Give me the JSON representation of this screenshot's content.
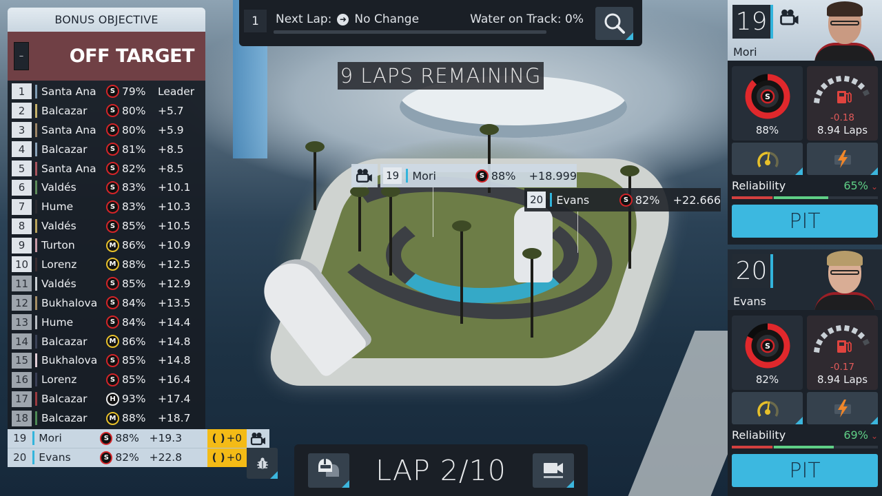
{
  "bonus_objective": {
    "title": "BONUS OBJECTIVE",
    "minus_label": "–",
    "status": "OFF TARGET"
  },
  "standings": [
    {
      "pos": "1",
      "driver": "Santa Ana",
      "tyre": "S",
      "wear": "79%",
      "gap": "Leader",
      "team_color": "#7f9bb3"
    },
    {
      "pos": "2",
      "driver": "Balcazar",
      "tyre": "S",
      "wear": "80%",
      "gap": "+5.7",
      "team_color": "#c7b26a"
    },
    {
      "pos": "3",
      "driver": "Santa Ana",
      "tyre": "S",
      "wear": "80%",
      "gap": "+5.9",
      "team_color": "#9c8566"
    },
    {
      "pos": "4",
      "driver": "Balcazar",
      "tyre": "S",
      "wear": "81%",
      "gap": "+8.5",
      "team_color": "#8aa3ba"
    },
    {
      "pos": "5",
      "driver": "Santa Ana",
      "tyre": "S",
      "wear": "82%",
      "gap": "+8.5",
      "team_color": "#a8545d"
    },
    {
      "pos": "6",
      "driver": "Valdés",
      "tyre": "S",
      "wear": "83%",
      "gap": "+10.1",
      "team_color": "#5d8c5a"
    },
    {
      "pos": "7",
      "driver": "Hume",
      "tyre": "S",
      "wear": "83%",
      "gap": "+10.3",
      "team_color": "#2a2a30"
    },
    {
      "pos": "8",
      "driver": "Valdés",
      "tyre": "S",
      "wear": "85%",
      "gap": "+10.5",
      "team_color": "#b9a45c"
    },
    {
      "pos": "9",
      "driver": "Turton",
      "tyre": "M",
      "wear": "86%",
      "gap": "+10.9",
      "team_color": "#c79aa6"
    },
    {
      "pos": "10",
      "driver": "Lorenz",
      "tyre": "M",
      "wear": "88%",
      "gap": "+12.5",
      "team_color": "#3a2c30"
    },
    {
      "pos": "11",
      "driver": "Valdés",
      "tyre": "S",
      "wear": "85%",
      "gap": "+12.9",
      "team_color": "#c9cdd2"
    },
    {
      "pos": "12",
      "driver": "Bukhalova",
      "tyre": "S",
      "wear": "84%",
      "gap": "+13.5",
      "team_color": "#a68f66"
    },
    {
      "pos": "13",
      "driver": "Hume",
      "tyre": "S",
      "wear": "84%",
      "gap": "+14.4",
      "team_color": "#b8bcc2"
    },
    {
      "pos": "14",
      "driver": "Balcazar",
      "tyre": "M",
      "wear": "86%",
      "gap": "+14.8",
      "team_color": "#3b4256"
    },
    {
      "pos": "15",
      "driver": "Bukhalova",
      "tyre": "S",
      "wear": "85%",
      "gap": "+14.8",
      "team_color": "#e1cdd6"
    },
    {
      "pos": "16",
      "driver": "Lorenz",
      "tyre": "S",
      "wear": "85%",
      "gap": "+16.4",
      "team_color": "#3a3f55"
    },
    {
      "pos": "17",
      "driver": "Balcazar",
      "tyre": "H",
      "wear": "93%",
      "gap": "+17.4",
      "team_color": "#9a3a40"
    },
    {
      "pos": "18",
      "driver": "Balcazar",
      "tyre": "M",
      "wear": "88%",
      "gap": "+18.7",
      "team_color": "#4d8a55"
    }
  ],
  "player_rows": [
    {
      "pos": "19",
      "driver": "Mori",
      "tyre": "S",
      "wear": "88%",
      "gap": "+19.3",
      "bonus": "+0"
    },
    {
      "pos": "20",
      "driver": "Evans",
      "tyre": "S",
      "wear": "82%",
      "gap": "+22.8",
      "bonus": "+0"
    }
  ],
  "topbar": {
    "lap_index": "1",
    "next_lap_label": "Next Lap:",
    "next_lap_value": "No Change",
    "water_label": "Water on Track:",
    "water_value": "0%"
  },
  "laps_remaining": "9 LAPS REMAINING",
  "track_tags": [
    {
      "pos": "19",
      "driver": "Mori",
      "tyre": "S",
      "wear": "88%",
      "gap": "+18.999"
    },
    {
      "pos": "20",
      "driver": "Evans",
      "tyre": "S",
      "wear": "82%",
      "gap": "+22.666"
    }
  ],
  "lap_counter": "LAP 2/10",
  "drivers": [
    {
      "number": "19",
      "name": "Mori",
      "tyre": "S",
      "tyre_wear": "88%",
      "tyre_wear_fraction": 0.88,
      "fuel_delta": "-0.18",
      "fuel_laps": "8.94 Laps",
      "reliability_label": "Reliability",
      "reliability_value": "65%",
      "reliability_fraction": 0.65,
      "pit_label": "PIT"
    },
    {
      "number": "20",
      "name": "Evans",
      "tyre": "S",
      "tyre_wear": "82%",
      "tyre_wear_fraction": 0.82,
      "fuel_delta": "-0.17",
      "fuel_laps": "8.94 Laps",
      "reliability_label": "Reliability",
      "reliability_value": "69%",
      "reliability_fraction": 0.69,
      "pit_label": "PIT"
    }
  ],
  "colors": {
    "accent": "#3cb8e0",
    "soft_tyre": "#d32428",
    "medium_tyre": "#e7c02a",
    "hard_tyre": "#eaeaea",
    "off_target": "#704045",
    "bonus_gold": "#f4bb16",
    "reliability_good": "#5fcf86",
    "reliability_bad": "#d3403f"
  }
}
